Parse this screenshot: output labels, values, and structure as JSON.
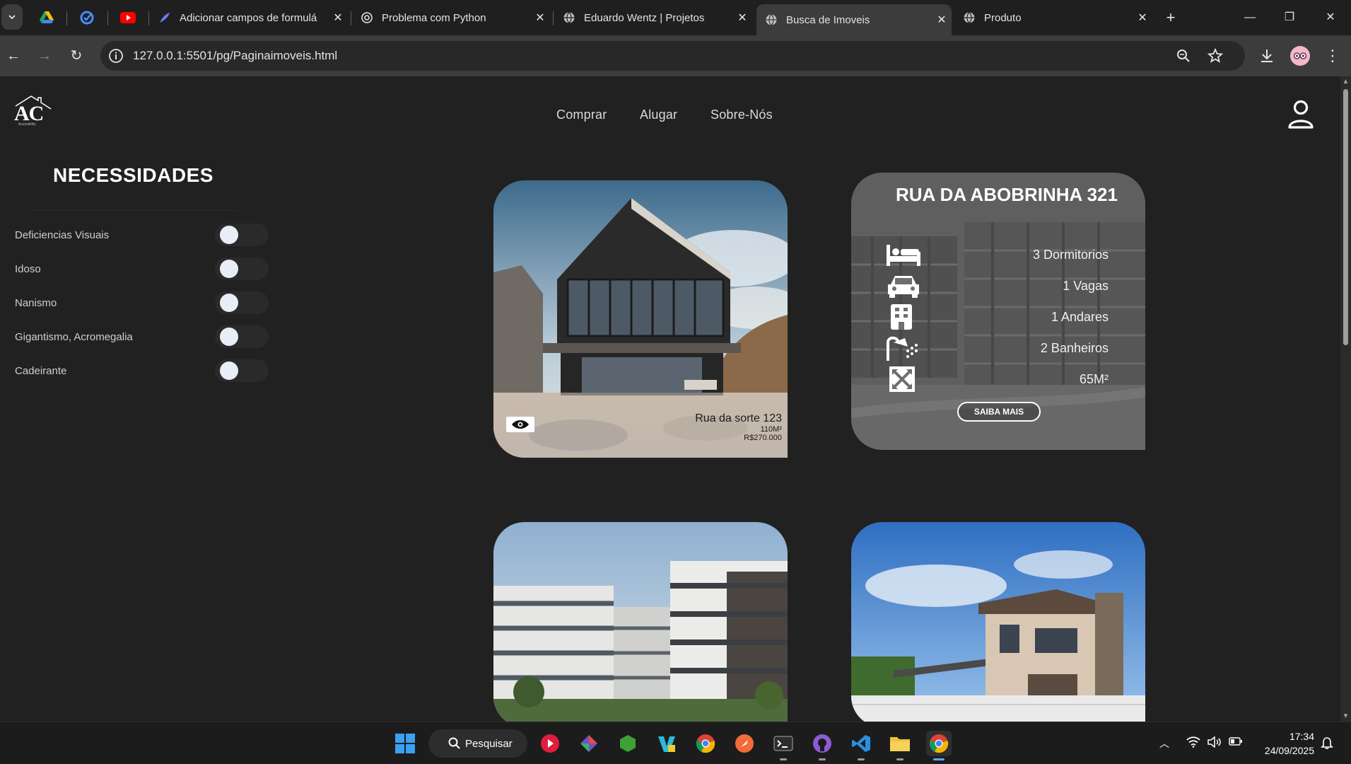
{
  "browser": {
    "tabs": [
      {
        "title": "Adicionar campos de formulá",
        "favicon": "feather-icon"
      },
      {
        "title": "Problema com Python",
        "favicon": "openai-icon"
      },
      {
        "title": "Eduardo Wentz | Projetos",
        "favicon": "globe-icon"
      },
      {
        "title": "Busca de Imoveis",
        "favicon": "globe-icon",
        "active": true
      },
      {
        "title": "Produto",
        "favicon": "globe-icon"
      }
    ],
    "pinned_tabs": [
      "google-drive-icon",
      "check-circle-icon",
      "youtube-icon"
    ],
    "url": "127.0.0.1:5501/pg/Paginaimoveis.html"
  },
  "site": {
    "logo_text": "AC",
    "logo_subtext": "Acessibility",
    "nav": [
      "Comprar",
      "Alugar",
      "Sobre-Nós"
    ]
  },
  "sidebar": {
    "title": "NECESSIDADES",
    "items": [
      {
        "label": "Deficiencias Visuais",
        "on": false
      },
      {
        "label": "Idoso",
        "on": false
      },
      {
        "label": "Nanismo",
        "on": false
      },
      {
        "label": "Gigantismo, Acromegalia",
        "on": false
      },
      {
        "label": "Cadeirante",
        "on": false
      }
    ]
  },
  "listings": {
    "card1": {
      "title": "Rua da sorte 123",
      "area": "110M²",
      "price": "R$270.000"
    },
    "card2": {
      "title": "RUA DA ABOBRINHA 321",
      "features": [
        {
          "icon": "bed-icon",
          "value": "3 Dormitorios"
        },
        {
          "icon": "car-icon",
          "value": "1 Vagas"
        },
        {
          "icon": "building-icon",
          "value": "1 Andares"
        },
        {
          "icon": "shower-icon",
          "value": "2 Banheiros"
        },
        {
          "icon": "expand-icon",
          "value": "65M²"
        }
      ],
      "button": "SAIBA MAIS"
    }
  },
  "taskbar": {
    "search_label": "Pesquisar",
    "time": "17:34",
    "date": "24/09/2025"
  }
}
